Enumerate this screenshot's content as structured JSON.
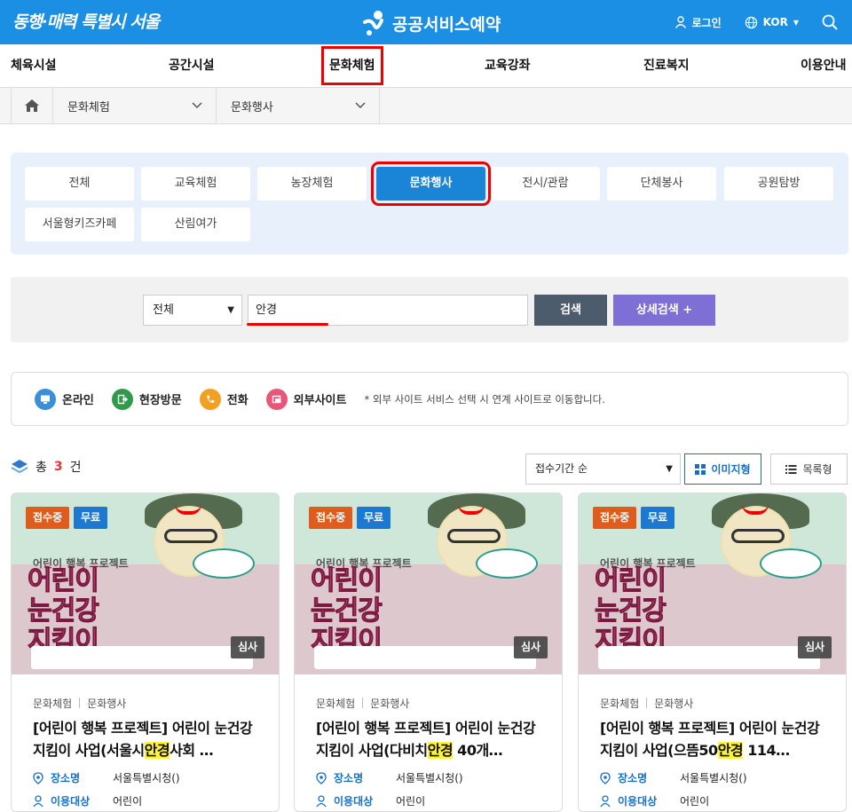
{
  "header": {
    "city_slogan": "동행·매력 특별시 서울",
    "service_name": "공공서비스예약",
    "login_label": "로그인",
    "language_label": "KOR"
  },
  "main_nav": {
    "items": [
      {
        "label": "체육시설"
      },
      {
        "label": "공간시설"
      },
      {
        "label": "문화체험",
        "active": true
      },
      {
        "label": "교육강좌"
      },
      {
        "label": "진료복지"
      },
      {
        "label": "이용안내"
      }
    ]
  },
  "breadcrumb": {
    "level1": "문화체험",
    "level2": "문화행사"
  },
  "categories": [
    {
      "label": "전체"
    },
    {
      "label": "교육체험"
    },
    {
      "label": "농장체험"
    },
    {
      "label": "문화행사",
      "active": true
    },
    {
      "label": "전시/관람"
    },
    {
      "label": "단체봉사"
    },
    {
      "label": "공원탐방"
    },
    {
      "label": "서울형키즈카페"
    },
    {
      "label": "산림여가"
    }
  ],
  "search": {
    "scope_value": "전체",
    "query_value": "안경",
    "search_button": "검색",
    "advanced_button": "상세검색 +"
  },
  "legend": {
    "online": "온라인",
    "visit": "현장방문",
    "phone": "전화",
    "external": "외부사이트",
    "note": "* 외부 사이트 서비스 선택 시 연계 사이트로 이동합니다."
  },
  "results": {
    "total_prefix": "총",
    "total_count": "3",
    "total_suffix": "건",
    "sort_value": "접수기간 순",
    "view_image": "이미지형",
    "view_list": "목록형"
  },
  "card_labels": {
    "status": "접수중",
    "free": "무료",
    "review": "심사",
    "place_key": "장소명",
    "target_key": "이용대상"
  },
  "poster": {
    "subtitle": "어린이 행복 프로젝트",
    "line1": "어린이",
    "line2": "눈건강",
    "line3": "지킴이"
  },
  "cards": [
    {
      "cat1": "문화체험",
      "cat2": "문화행사",
      "title_before": "[어린이 행복 프로젝트] 어린이 눈건강 지킴이 사업(서울시",
      "title_highlight": "안경",
      "title_after": "사회 …",
      "place": "서울특별시청()",
      "target": "어린이"
    },
    {
      "cat1": "문화체험",
      "cat2": "문화행사",
      "title_before": "[어린이 행복 프로젝트] 어린이 눈건강 지킴이 사업(다비치",
      "title_highlight": "안경",
      "title_after": " 40개…",
      "place": "서울특별시청()",
      "target": "어린이"
    },
    {
      "cat1": "문화체험",
      "cat2": "문화행사",
      "title_before": "[어린이 행복 프로젝트] 어린이 눈건강 지킴이 사업(으뜸50",
      "title_highlight": "안경",
      "title_after": " 114…",
      "place": "서울특별시청()",
      "target": "어린이"
    }
  ],
  "colors": {
    "header_blue": "#1a8fe3",
    "active_category": "#1a85d6",
    "highlight_annotation": "#e00000",
    "status_orange": "#e05c1d",
    "free_blue": "#1d78cf",
    "advanced_purple": "#7d6fd6"
  },
  "icons": [
    "person-icon",
    "globe-icon",
    "search-icon",
    "home-icon",
    "chevron-down-icon",
    "monitor-icon",
    "door-icon",
    "phone-icon",
    "external-icon",
    "layers-icon",
    "grid-icon",
    "list-icon",
    "pin-icon",
    "user-icon"
  ]
}
